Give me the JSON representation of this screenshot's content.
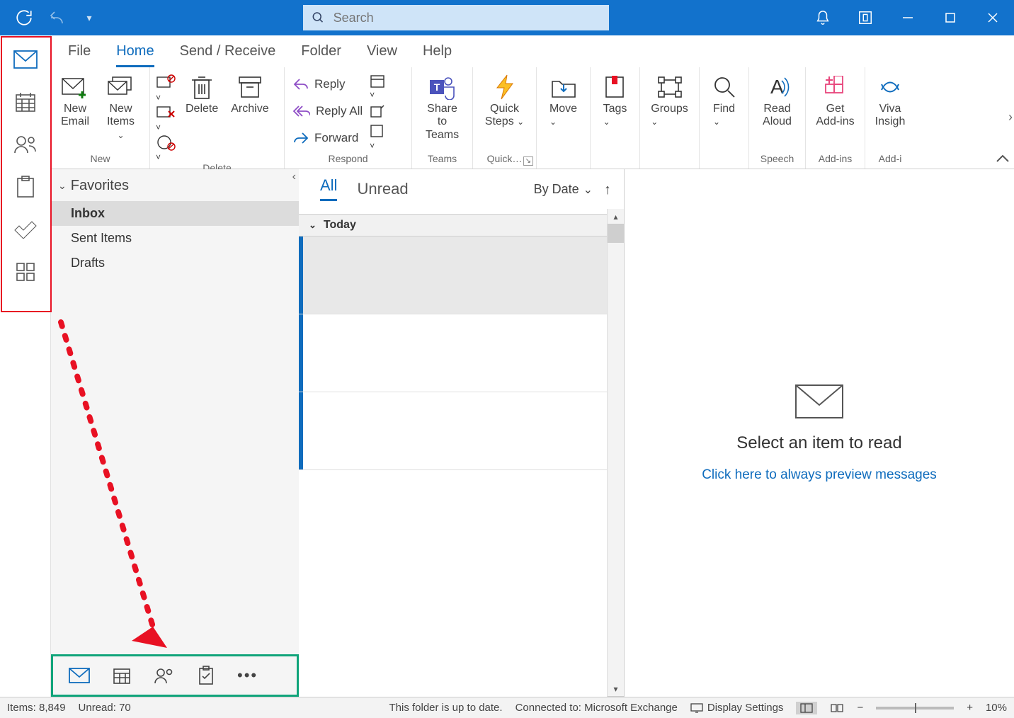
{
  "titlebar": {
    "search_placeholder": "Search"
  },
  "menu": {
    "tabs": [
      "File",
      "Home",
      "Send / Receive",
      "Folder",
      "View",
      "Help"
    ],
    "active": "Home"
  },
  "ribbon": {
    "new": {
      "label": "New",
      "new_email": "New\nEmail",
      "new_items": "New\nItems"
    },
    "delete": {
      "label": "Delete",
      "delete": "Delete",
      "archive": "Archive"
    },
    "respond": {
      "label": "Respond",
      "reply": "Reply",
      "reply_all": "Reply All",
      "forward": "Forward"
    },
    "teams": {
      "label": "Teams",
      "share": "Share to\nTeams"
    },
    "quicksteps": {
      "label": "Quick…",
      "quick": "Quick\nSteps"
    },
    "move": {
      "label": "Move"
    },
    "tags": {
      "label": "Tags"
    },
    "groups": {
      "label": "Groups"
    },
    "find": {
      "label": "Find"
    },
    "speech": {
      "label": "Speech",
      "read": "Read\nAloud"
    },
    "addins": {
      "label": "Add-ins",
      "get": "Get\nAdd-ins"
    },
    "viva": {
      "label": "Add-i",
      "viva": "Viva\nInsigh"
    }
  },
  "folders": {
    "favorites_label": "Favorites",
    "items": [
      {
        "label": "Inbox",
        "selected": true
      },
      {
        "label": "Sent Items",
        "selected": false
      },
      {
        "label": "Drafts",
        "selected": false
      }
    ]
  },
  "messagelist": {
    "tabs": {
      "all": "All",
      "unread": "Unread"
    },
    "sort_label": "By Date",
    "group_today": "Today"
  },
  "reading": {
    "title": "Select an item to read",
    "link": "Click here to always preview messages"
  },
  "statusbar": {
    "items": "Items: 8,849",
    "unread": "Unread: 70",
    "folder_status": "This folder is up to date.",
    "connection": "Connected to: Microsoft Exchange",
    "display": "Display Settings",
    "zoom": "10%"
  }
}
